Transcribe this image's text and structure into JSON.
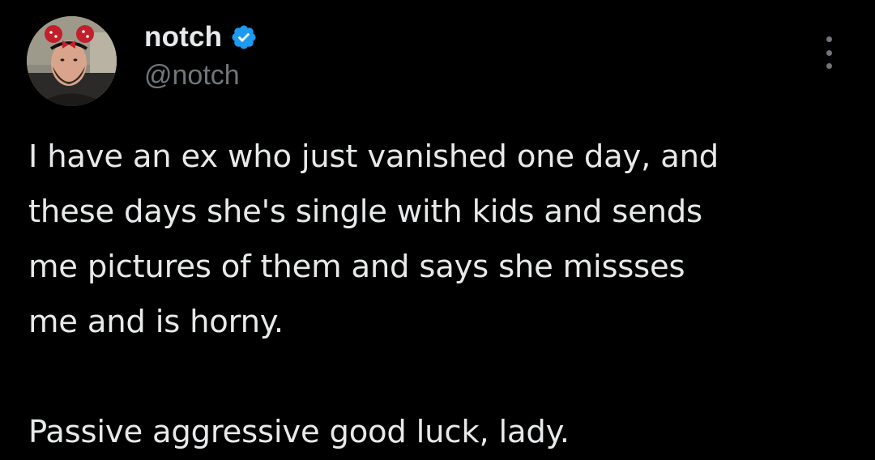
{
  "author": {
    "display_name": "notch",
    "handle": "@notch",
    "verified": true,
    "verified_color": "#1d9bf0"
  },
  "tweet": {
    "lines": [
      "I have an ex who just vanished one day, and",
      "these days she's single with kids and sends",
      "me pictures of them and says she missses",
      "me and is horny."
    ],
    "closing": "Passive aggressive good luck, lady."
  },
  "icons": {
    "verified": "verified-badge-icon",
    "more": "more-options-icon"
  },
  "colors": {
    "background": "#000000",
    "text": "#e7e9ea",
    "secondary": "#71767b"
  }
}
